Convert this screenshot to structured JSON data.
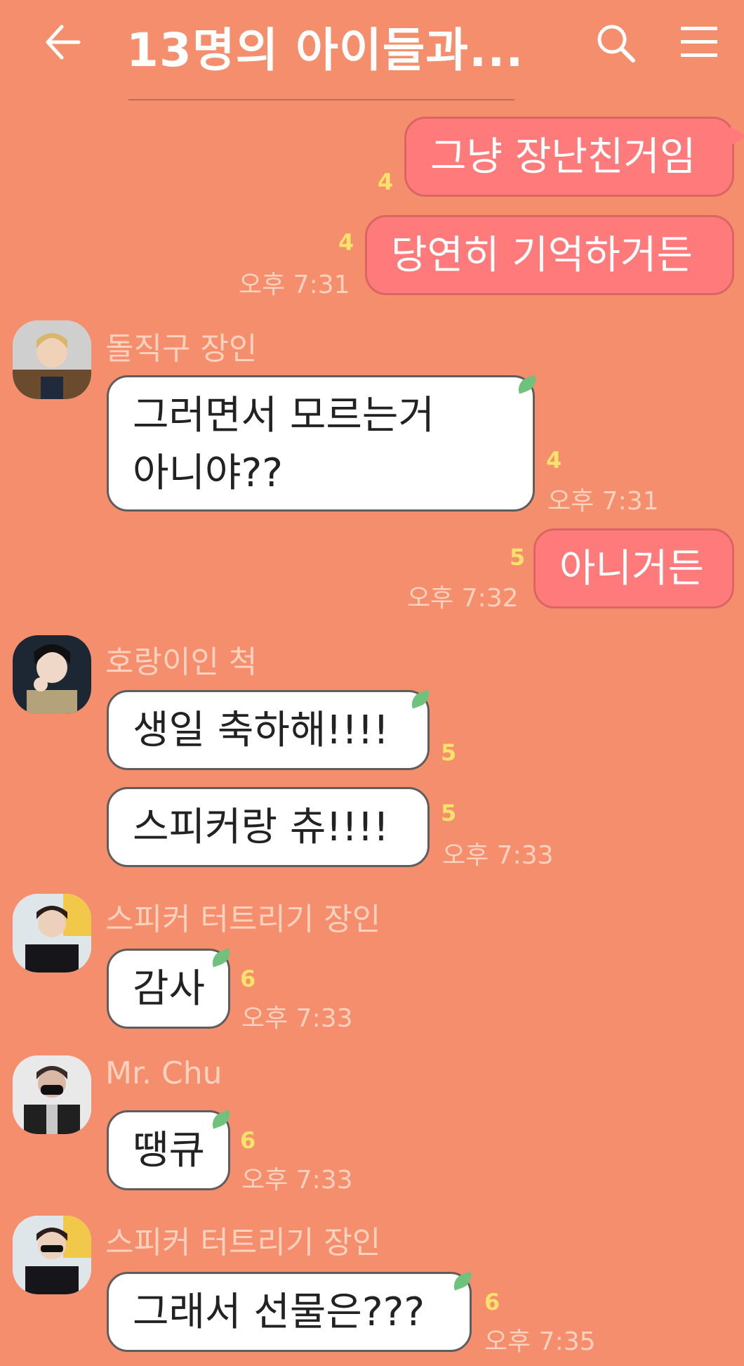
{
  "header": {
    "title": "13명의 아이들과...",
    "back_icon": "arrow-left-icon",
    "search_icon": "search-icon",
    "menu_icon": "hamburger-menu-icon"
  },
  "colors": {
    "background": "#f58e6c",
    "my_bubble": "#ff7b7b",
    "other_bubble": "#ffffff",
    "read_count": "#f7e26b"
  },
  "messages": [
    {
      "sender": "me",
      "text": "그냥 장난친거임",
      "count": "4"
    },
    {
      "sender": "me",
      "text": "당연히 기억하거든",
      "count": "4",
      "time": "오후 7:31"
    },
    {
      "sender": "돌직구 장인",
      "text": "그러면서 모르는거 아니야??",
      "line1": "그러면서 모르는거",
      "line2": "아니야??",
      "count": "4",
      "time": "오후 7:31"
    },
    {
      "sender": "me",
      "text": "아니거든",
      "count": "5",
      "time": "오후 7:32"
    },
    {
      "sender": "호랑이인 척",
      "text": "생일 축하해!!!!",
      "count": "5"
    },
    {
      "sender": "호랑이인 척",
      "text": "스피커랑 츄!!!!",
      "count": "5",
      "time": "오후 7:33"
    },
    {
      "sender": "스피커 터트리기 장인",
      "text": "감사",
      "count": "6",
      "time": "오후 7:33"
    },
    {
      "sender": "Mr. Chu",
      "text": "땡큐",
      "count": "6",
      "time": "오후 7:33"
    },
    {
      "sender": "스피커 터트리기 장인",
      "text": "그래서 선물은???",
      "count": "6",
      "time": "오후 7:35"
    }
  ]
}
